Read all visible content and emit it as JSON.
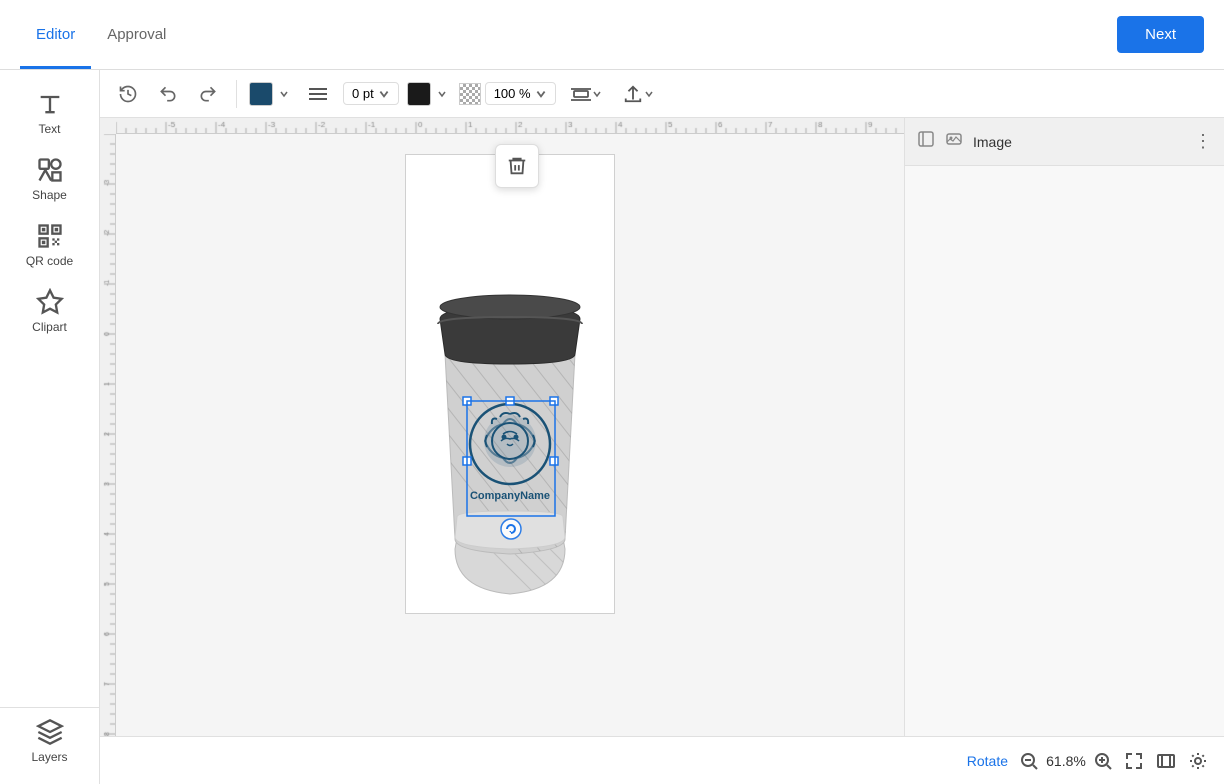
{
  "header": {
    "tab_editor": "Editor",
    "tab_approval": "Approval",
    "next_btn": "Next"
  },
  "toolbar": {
    "stroke_color": "#1a4a6b",
    "stroke_width": "0 pt",
    "fill_color": "#000000",
    "opacity": "100 %",
    "align_icon": "align-icon",
    "upload_icon": "upload-icon",
    "history_icon": "history-icon",
    "undo_icon": "undo-icon",
    "redo_icon": "redo-icon",
    "dropdown_arrow": "▼"
  },
  "sidebar": {
    "items": [
      {
        "label": "Text",
        "icon": "text-icon"
      },
      {
        "label": "Shape",
        "icon": "shape-icon"
      },
      {
        "label": "QR code",
        "icon": "qrcode-icon"
      },
      {
        "label": "Clipart",
        "icon": "clipart-icon"
      },
      {
        "label": "Layers",
        "icon": "layers-icon"
      }
    ]
  },
  "canvas": {
    "zoom_level": "61.8%",
    "rotate_label": "Rotate"
  },
  "right_panel": {
    "title": "Image",
    "more_icon": "more-icon"
  },
  "company_name": "CompanyName",
  "delete_tooltip": "Delete"
}
